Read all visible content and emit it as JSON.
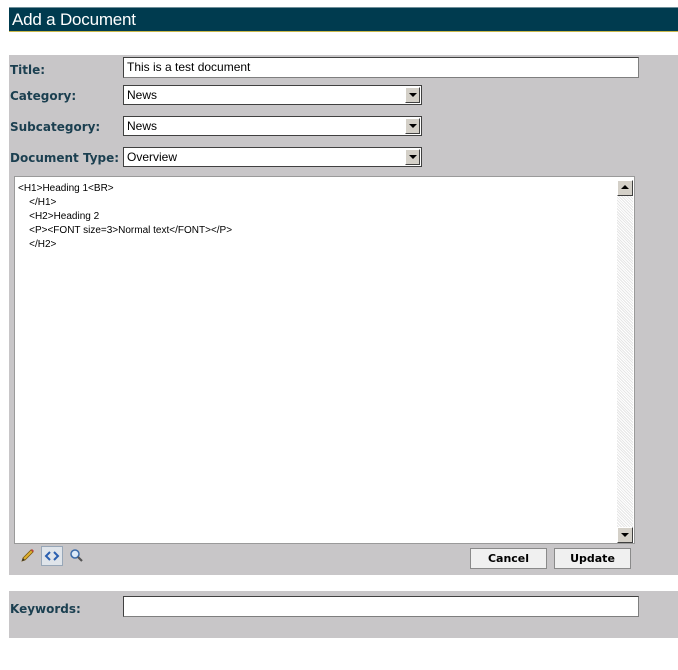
{
  "header": {
    "title": "Add a Document"
  },
  "form": {
    "title_label": "Title:",
    "title_value": "This is a test document",
    "category_label": "Category:",
    "category_value": "News",
    "subcategory_label": "Subcategory:",
    "subcategory_value": "News",
    "doctype_label": "Document Type:",
    "doctype_value": "Overview",
    "keywords_label": "Keywords:",
    "keywords_value": ""
  },
  "editor": {
    "content": "<H1>Heading 1<BR>\n    </H1>\n    <H2>Heading 2\n    <P><FONT size=3>Normal text</FONT></P>\n    </H2>"
  },
  "toolbar": {
    "icons": [
      "pencil-icon",
      "code-view-icon",
      "preview-icon"
    ],
    "cancel_label": "Cancel",
    "update_label": "Update"
  },
  "colors": {
    "header_bg": "#003b4f",
    "panel_bg": "#c8c6c8",
    "label_text": "#1b3f50"
  }
}
